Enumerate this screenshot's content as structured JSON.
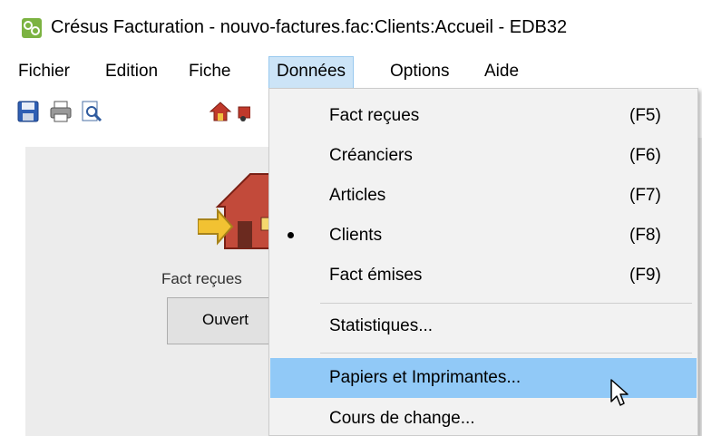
{
  "window": {
    "title": "Crésus Facturation - nouvo-factures.fac:Clients:Accueil - EDB32"
  },
  "menubar": {
    "items": [
      {
        "label": "Fichier"
      },
      {
        "label": "Edition"
      },
      {
        "label": "Fiche"
      },
      {
        "label": "Données",
        "active": true
      },
      {
        "label": "Options"
      },
      {
        "label": "Aide"
      }
    ]
  },
  "toolbar": {
    "icons": [
      "save-icon",
      "print-icon",
      "print-preview-icon",
      "home-icon",
      "truck-icon"
    ]
  },
  "panel": {
    "label": "Fact reçues",
    "button_label": "Ouvert"
  },
  "dropdown": {
    "items": [
      {
        "label": "Fact reçues",
        "shortcut": "(F5)",
        "checked": false
      },
      {
        "label": "Créanciers",
        "shortcut": "(F6)",
        "checked": false
      },
      {
        "label": "Articles",
        "shortcut": "(F7)",
        "checked": false
      },
      {
        "label": "Clients",
        "shortcut": "(F8)",
        "checked": true
      },
      {
        "label": "Fact émises",
        "shortcut": "(F9)",
        "checked": false
      },
      {
        "label": "Statistiques...",
        "shortcut": "",
        "checked": false
      },
      {
        "label": "Papiers et Imprimantes...",
        "shortcut": "",
        "checked": false,
        "highlighted": true
      },
      {
        "label": "Cours de change...",
        "shortcut": "",
        "checked": false
      }
    ]
  },
  "colors": {
    "menu_active_bg": "#cce4f7",
    "menu_hover_bg": "#91c9f7",
    "dropdown_bg": "#f2f2f2",
    "panel_bg": "#ececec"
  }
}
